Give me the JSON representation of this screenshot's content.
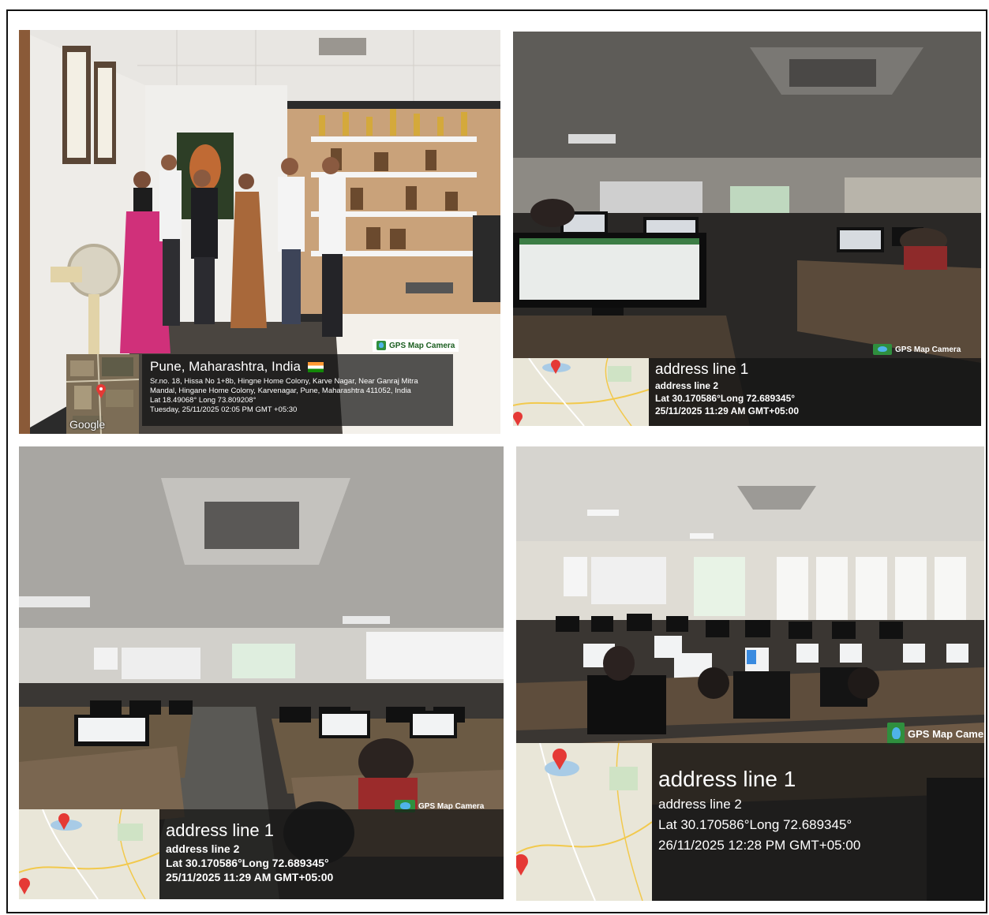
{
  "photos": [
    {
      "gps_badge": "GPS Map Camera",
      "location_title": "Pune, Maharashtra, India",
      "flag_icon": "india-flag-icon",
      "address": "Sr.no. 18, Hissa No 1+8b, Hingne Home Colony, Karve Nagar, Near Ganraj Mitra Mandal, Hingane Home Colony, Karvenagar, Pune, Maharashtra 411052, India",
      "coords": "Lat 18.49068° Long 73.809208°",
      "timestamp": "Tuesday, 25/11/2025 02:05 PM GMT +05:30",
      "map_label": "Google"
    },
    {
      "gps_badge": "GPS Map Camera",
      "line1": "address line 1",
      "line2": "address line 2",
      "coords": "Lat 30.170586°Long 72.689345°",
      "timestamp": "25/11/2025 11:29 AM GMT+05:00"
    },
    {
      "gps_badge": "GPS Map Camera",
      "line1": "address line 1",
      "line2": "address line 2",
      "coords": "Lat 30.170586°Long 72.689345°",
      "timestamp": "25/11/2025 11:29 AM GMT+05:00"
    },
    {
      "gps_badge": "GPS Map Camera",
      "line1": "address line 1",
      "line2": "address line 2",
      "coords": "Lat 30.170586°Long 72.689345°",
      "timestamp": "26/11/2025 12:28 PM GMT+05:00"
    }
  ],
  "colors": {
    "overlay": "#141414",
    "map_land": "#e9e6d8",
    "map_pin": "#e53935",
    "gps_green": "#2f8f3e"
  }
}
